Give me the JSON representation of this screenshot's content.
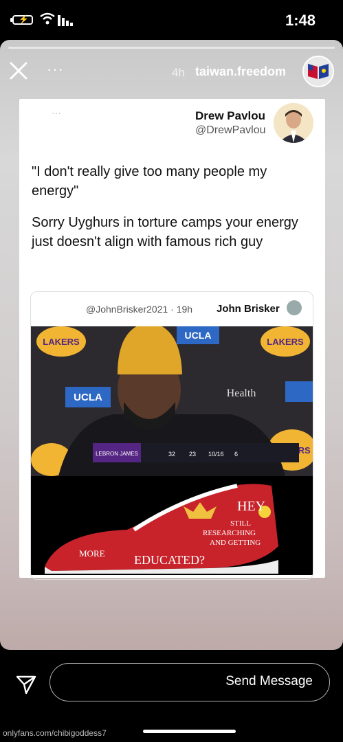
{
  "status": {
    "time": "1:48"
  },
  "story": {
    "username": "taiwan.freedom",
    "time_ago": "4h",
    "more_label": "···"
  },
  "tweet": {
    "name": "Drew Pavlou",
    "handle": "@DrewPavlou",
    "dots": "···",
    "text_1": "\"I don't really give too many people my energy\"",
    "text_2": "Sorry Uyghurs in torture camps your energy just doesn't align with famous rich guy"
  },
  "quoted": {
    "name": "John Brisker",
    "meta": "@JohnBrisker2021 · 19h",
    "image_labels": {
      "ucla": "UCLA",
      "health": "Health",
      "lakers": "LAKERS"
    },
    "shoe_text": {
      "hey": "HEY",
      "still": "STILL",
      "researching": "RESEARCHING",
      "and_getting": "AND GETTING",
      "educated": "EDUCATED?",
      "more": "MORE"
    },
    "scorebox": {
      "player": "LEBRON JAMES",
      "min": "32",
      "pts": "23",
      "fg": "10/16",
      "reb": "6"
    }
  },
  "bottom": {
    "placeholder": "Send Message",
    "watermark": "onlyfans.com/chibigoddess7"
  },
  "colors": {
    "shoe_red": "#c8232b",
    "beanie": "#e0a62a",
    "lakers_purple": "#552583",
    "lakers_gold": "#f2b533"
  }
}
